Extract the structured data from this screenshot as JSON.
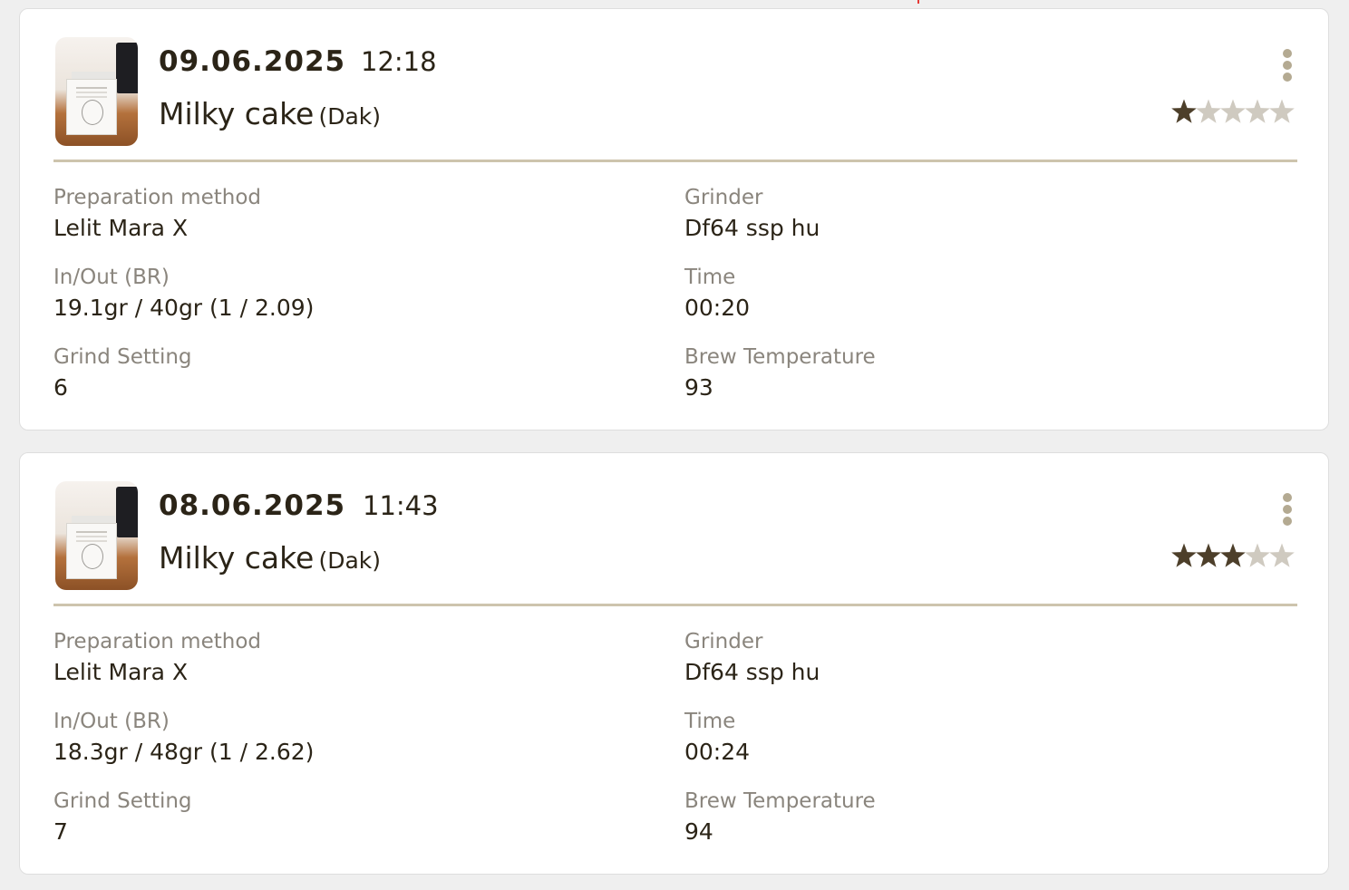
{
  "colors": {
    "star_filled": "#4d3f2a",
    "star_empty": "#cfcac0",
    "divider": "#cdc4ad",
    "menu_dots": "#b4aa92",
    "label": "#8a857d",
    "text": "#2b2417",
    "background": "#efefef",
    "card": "#ffffff"
  },
  "labels": {
    "preparation_method": "Preparation method",
    "grinder": "Grinder",
    "in_out": "In/Out (BR)",
    "time": "Time",
    "grind_setting": "Grind Setting",
    "brew_temperature": "Brew Temperature"
  },
  "brews": [
    {
      "date": "09.06.2025",
      "time": "12:18",
      "bean_name": "Milky cake",
      "roaster": "(Dak)",
      "rating": 1,
      "rating_max": 5,
      "thumbnail_icon": "coffee-box-photo",
      "menu_icon": "more-vertical-icon",
      "preparation_method": "Lelit Mara X",
      "grinder": "Df64 ssp hu",
      "in_out": "19.1gr / 40gr (1 / 2.09)",
      "brew_time": "00:20",
      "grind_setting": "6",
      "brew_temperature": "93"
    },
    {
      "date": "08.06.2025",
      "time": "11:43",
      "bean_name": "Milky cake",
      "roaster": "(Dak)",
      "rating": 3,
      "rating_max": 5,
      "thumbnail_icon": "coffee-box-photo",
      "menu_icon": "more-vertical-icon",
      "preparation_method": "Lelit Mara X",
      "grinder": "Df64 ssp hu",
      "in_out": "18.3gr / 48gr (1 / 2.62)",
      "brew_time": "00:24",
      "grind_setting": "7",
      "brew_temperature": "94"
    }
  ]
}
